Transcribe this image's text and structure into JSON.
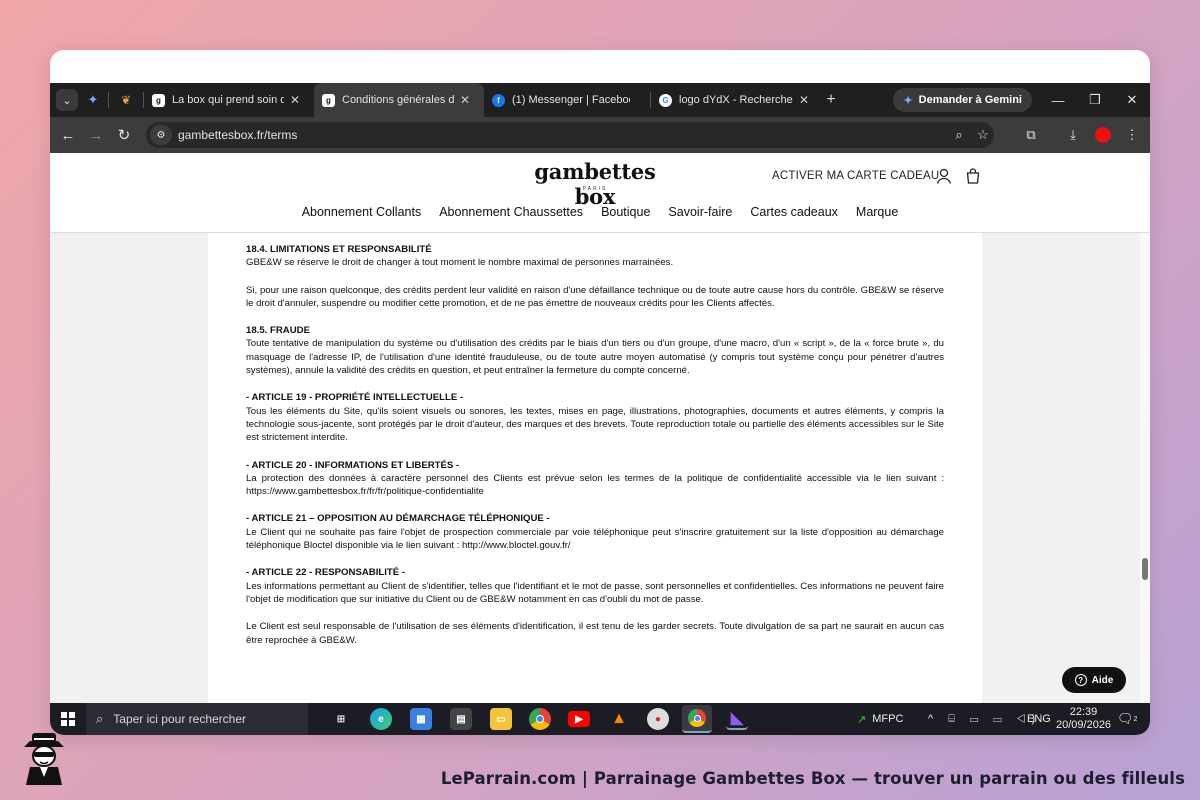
{
  "browser": {
    "tabs": [
      {
        "title": "La box qui prend soin de",
        "favicon": "gambettes-box-logo"
      },
      {
        "title": "Conditions générales de v",
        "favicon": "gambettes-box-logo",
        "active": true
      },
      {
        "title": "(1) Messenger | Facebook",
        "favicon": "facebook-icon"
      },
      {
        "title": "logo dYdX - Recherche Go",
        "favicon": "google-icon"
      }
    ],
    "gemini_button": "Demander à Gemini",
    "url": "gambettesbox.fr/terms"
  },
  "site": {
    "logo": "gambettes box",
    "logo_sub": "PARIS",
    "gift_card_link": "ACTIVER MA CARTE CADEAU",
    "menu": [
      "Abonnement Collants",
      "Abonnement Chaussettes",
      "Boutique",
      "Savoir-faire",
      "Cartes cadeaux",
      "Marque"
    ]
  },
  "content": {
    "sections": [
      {
        "heading": "18.4. LIMITATIONS ET RESPONSABILITÉ",
        "body": "GBE&W se réserve le droit de changer à tout moment le nombre maximal de personnes marrainées."
      },
      {
        "heading": "",
        "body": "Si, pour une raison quelconque, des crédits perdent leur validité en raison d'une défaillance technique ou de toute autre cause hors du contrôle. GBE&W se réserve le droit d'annuler, suspendre ou modifier cette promotion, et de ne pas émettre de nouveaux crédits pour les Clients affectés."
      },
      {
        "heading": "18.5. FRAUDE",
        "body": "Toute tentative de manipulation du système ou d'utilisation des crédits par le biais d'un tiers ou d'un groupe, d'une macro, d'un « script », de la « force brute », du masquage de l'adresse IP, de l'utilisation d'une identité frauduleuse, ou de toute autre moyen automatisé (y compris tout système conçu pour pénétrer d'autres systèmes), annule la validité des crédits en question, et peut entraîner la fermeture du compte concerné."
      },
      {
        "heading": "- ARTICLE 19 - PROPRIÉTÉ INTELLECTUELLE -",
        "body": "Tous les éléments du Site, qu'ils soient visuels ou sonores, les textes, mises en page, illustrations, photographies, documents et autres éléments, y compris la technologie sous-jacente, sont protégés par le droit d'auteur, des marques et des brevets. Toute reproduction totale ou partielle des éléments accessibles sur le Site est strictement interdite."
      },
      {
        "heading": "- ARTICLE 20 - INFORMATIONS ET LIBERTÉS -",
        "body": "La protection des données à caractère personnel des Clients est prévue selon les termes de la politique de confidentialité accessible via le lien suivant : https://www.gambettesbox.fr/fr/fr/politique-confidentialite"
      },
      {
        "heading": "- ARTICLE 21 – OPPOSITION AU DÉMARCHAGE TÉLÉPHONIQUE -",
        "body": "Le Client qui ne souhaite pas faire l'objet de prospection commerciale par voie téléphonique peut s'inscrire gratuitement sur la liste d'opposition au démarchage téléphonique Bloctel disponible via le lien suivant : http://www.bloctel.gouv.fr/"
      },
      {
        "heading": "- ARTICLE 22 - RESPONSABILITÉ -",
        "body": "Les informations permettant au Client de s'identifier, telles que l'identifiant et le mot de passe, sont personnelles et confidentielles. Ces informations ne peuvent faire l'objet de modification que sur initiative du Client ou de GBE&W notamment en cas d'oubli du mot de passe."
      },
      {
        "heading": "",
        "body": "Le Client est seul responsable de l'utilisation de ses éléments d'identification, il est tenu de les garder secrets. Toute divulgation de sa part ne saurait en aucun cas être reprochée à GBE&W."
      }
    ],
    "help_button": "Aide"
  },
  "taskbar": {
    "search_placeholder": "Taper ici pour rechercher",
    "stock": "MFPC",
    "lang": "ENG",
    "time": "22:39",
    "date": "20/09/2026",
    "notif_count": "2"
  },
  "footer": "LeParrain.com | Parrainage Gambettes Box — trouver un parrain ou des filleuls"
}
